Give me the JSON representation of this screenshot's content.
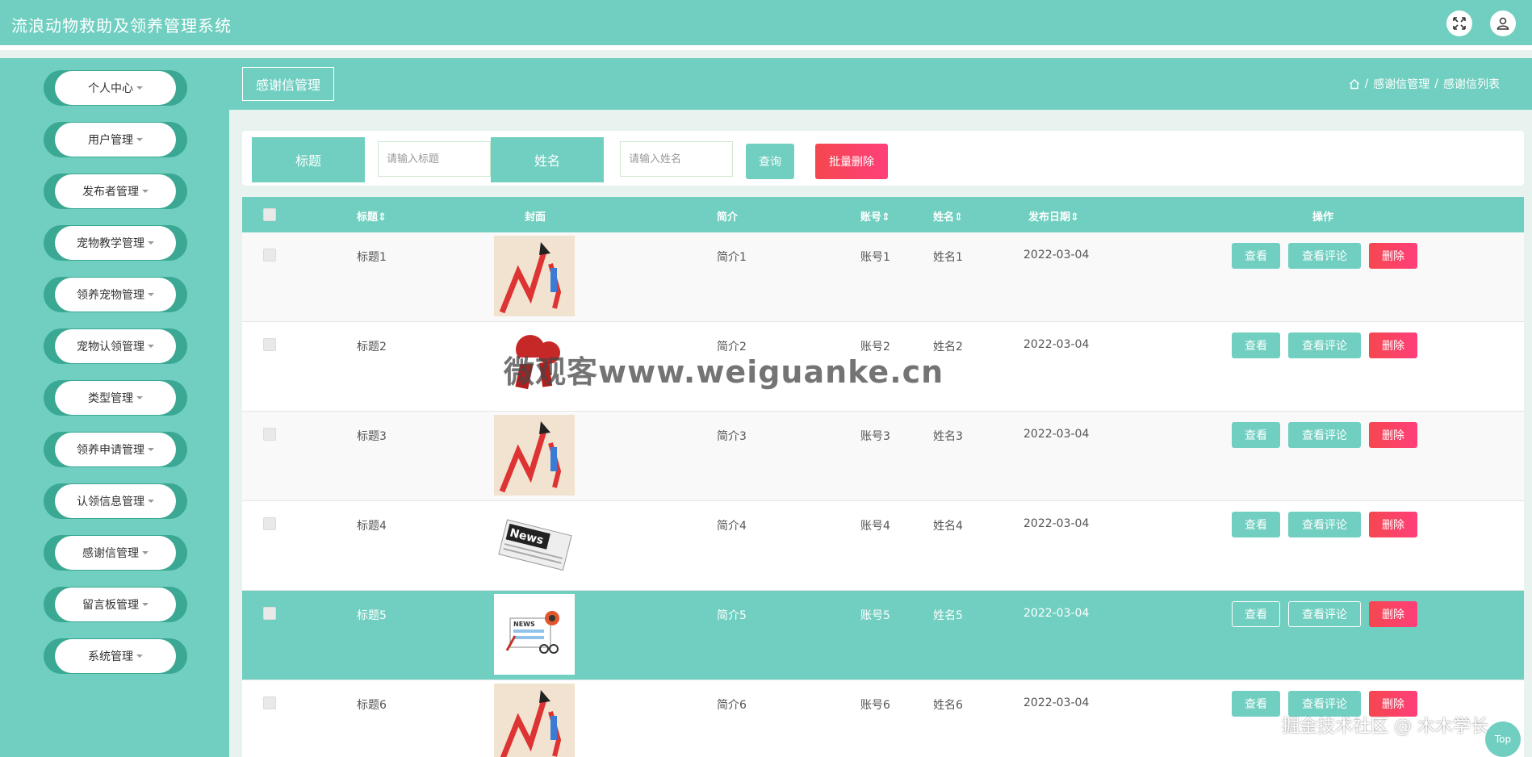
{
  "app": {
    "title": "流浪动物救助及领养管理系统"
  },
  "sidebar": {
    "items": [
      {
        "label": "个人中心"
      },
      {
        "label": "用户管理"
      },
      {
        "label": "发布者管理"
      },
      {
        "label": "宠物教学管理"
      },
      {
        "label": "领养宠物管理"
      },
      {
        "label": "宠物认领管理"
      },
      {
        "label": "类型管理"
      },
      {
        "label": "领养申请管理"
      },
      {
        "label": "认领信息管理"
      },
      {
        "label": "感谢信管理"
      },
      {
        "label": "留言板管理"
      },
      {
        "label": "系统管理"
      }
    ]
  },
  "page": {
    "title": "感谢信管理",
    "breadcrumb": [
      "感谢信管理",
      "感谢信列表"
    ]
  },
  "search": {
    "title_label": "标题",
    "title_placeholder": "请输入标题",
    "name_label": "姓名",
    "name_placeholder": "请输入姓名",
    "query_label": "查询",
    "batch_delete_label": "批量删除"
  },
  "table": {
    "columns": [
      "标题",
      "封面",
      "简介",
      "账号",
      "姓名",
      "发布日期",
      "操作"
    ],
    "actions": {
      "view": "查看",
      "comments": "查看评论",
      "delete": "删除"
    },
    "rows": [
      {
        "title": "标题1",
        "intro": "简介1",
        "account": "账号1",
        "name": "姓名1",
        "date": "2022-03-04",
        "cover": "chart-graphic"
      },
      {
        "title": "标题2",
        "intro": "简介2",
        "account": "账号2",
        "name": "姓名2",
        "date": "2022-03-04",
        "cover": "microphone-graphic"
      },
      {
        "title": "标题3",
        "intro": "简介3",
        "account": "账号3",
        "name": "姓名3",
        "date": "2022-03-04",
        "cover": "chart-graphic"
      },
      {
        "title": "标题4",
        "intro": "简介4",
        "account": "账号4",
        "name": "姓名4",
        "date": "2022-03-04",
        "cover": "newspaper-graphic"
      },
      {
        "title": "标题5",
        "intro": "简介5",
        "account": "账号5",
        "name": "姓名5",
        "date": "2022-03-04",
        "cover": "news-desk-graphic"
      },
      {
        "title": "标题6",
        "intro": "简介6",
        "account": "账号6",
        "name": "姓名6",
        "date": "2022-03-04",
        "cover": "chart-graphic"
      }
    ]
  },
  "watermarks": {
    "center": "微观客www.weiguanke.cn",
    "corner": "掘金技术社区 @ 木木学长"
  },
  "back_to_top": {
    "label": "Top"
  },
  "colors": {
    "primary": "#70cfc0",
    "danger": "#f5474f",
    "sidebar_dark": "#3aa893"
  }
}
